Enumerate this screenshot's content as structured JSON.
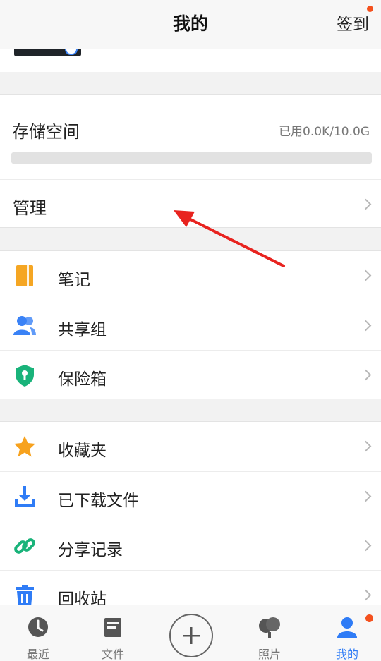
{
  "header": {
    "title": "我的",
    "signin_label": "签到"
  },
  "storage": {
    "label": "存储空间",
    "used_text": "已用0.0K/10.0G",
    "used_fraction": 0.0,
    "manage_label": "管理"
  },
  "group_tools": [
    {
      "label": "笔记",
      "icon": "notebook-icon"
    },
    {
      "label": "共享组",
      "icon": "people-icon"
    },
    {
      "label": "保险箱",
      "icon": "shield-lock-icon"
    }
  ],
  "group_files": [
    {
      "label": "收藏夹",
      "icon": "star-icon"
    },
    {
      "label": "已下载文件",
      "icon": "download-icon"
    },
    {
      "label": "分享记录",
      "icon": "link-icon"
    },
    {
      "label": "回收站",
      "icon": "trash-icon"
    }
  ],
  "tabs": [
    {
      "label": "最近",
      "icon": "clock-icon"
    },
    {
      "label": "文件",
      "icon": "folder-icon"
    },
    {
      "label": "",
      "icon": "plus-icon"
    },
    {
      "label": "照片",
      "icon": "photos-icon"
    },
    {
      "label": "我的",
      "icon": "user-icon"
    }
  ],
  "colors": {
    "accent": "#2f7cf6",
    "badge": "#f4511e",
    "annotation_arrow": "#e8231f"
  }
}
